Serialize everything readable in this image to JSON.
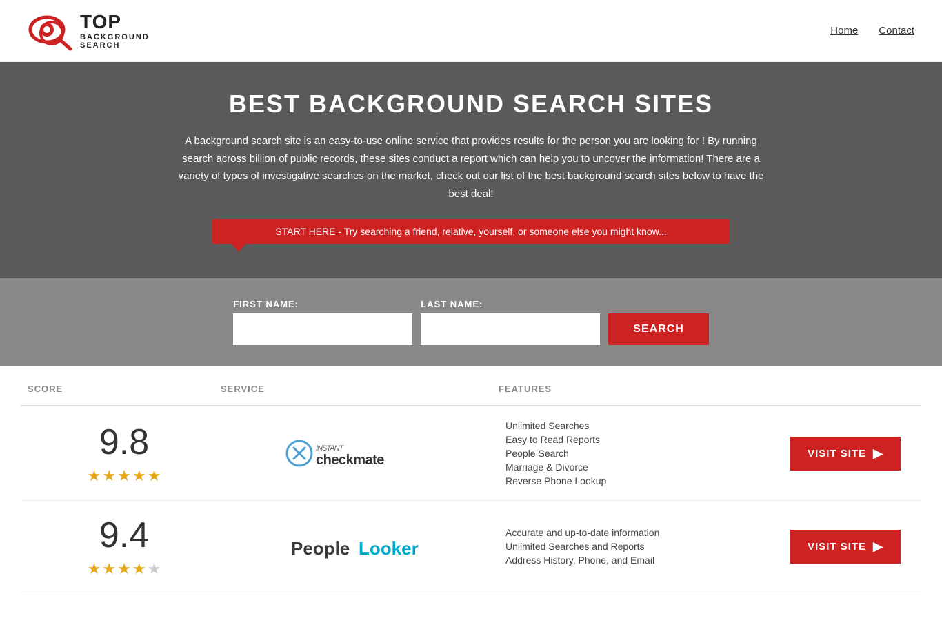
{
  "header": {
    "logo_top": "TOP",
    "logo_sub_line1": "BACKGROUND",
    "logo_sub_line2": "SEARCH",
    "nav": [
      {
        "label": "Home",
        "url": "#"
      },
      {
        "label": "Contact",
        "url": "#"
      }
    ]
  },
  "hero": {
    "title": "BEST BACKGROUND SEARCH SITES",
    "description": "A background search site is an easy-to-use online service that provides results  for the person you are looking for ! By  running  search across billion of public records, these sites conduct  a report which can help you to uncover the information! There are a variety of types of investigative searches on the market, check out our  list of the best background search sites below to have the best deal!",
    "callout": "START HERE - Try searching a friend, relative, yourself, or someone else you might know..."
  },
  "search_form": {
    "first_name_label": "FIRST NAME:",
    "last_name_label": "LAST NAME:",
    "button_label": "SEARCH",
    "first_name_placeholder": "",
    "last_name_placeholder": ""
  },
  "table": {
    "headers": {
      "score": "SCORE",
      "service": "SERVICE",
      "features": "FEATURES",
      "action": ""
    },
    "rows": [
      {
        "score": "9.8",
        "stars": 4.5,
        "service_name": "Instant Checkmate",
        "service_type": "checkmate",
        "features": [
          "Unlimited Searches",
          "Easy to Read Reports",
          "People Search",
          "Marriage & Divorce",
          "Reverse Phone Lookup"
        ],
        "visit_label": "VISIT SITE"
      },
      {
        "score": "9.4",
        "stars": 4,
        "service_name": "PeopleLooker",
        "service_type": "peoplelooker",
        "features": [
          "Accurate and up-to-date information",
          "Unlimited Searches and Reports",
          "Address History, Phone, and Email"
        ],
        "visit_label": "VISIT SITE"
      }
    ]
  },
  "colors": {
    "accent_red": "#cc2222",
    "hero_bg": "#5a5a5a",
    "search_bg": "#888888",
    "star_color": "#e6a817",
    "header_col": "#888888"
  }
}
